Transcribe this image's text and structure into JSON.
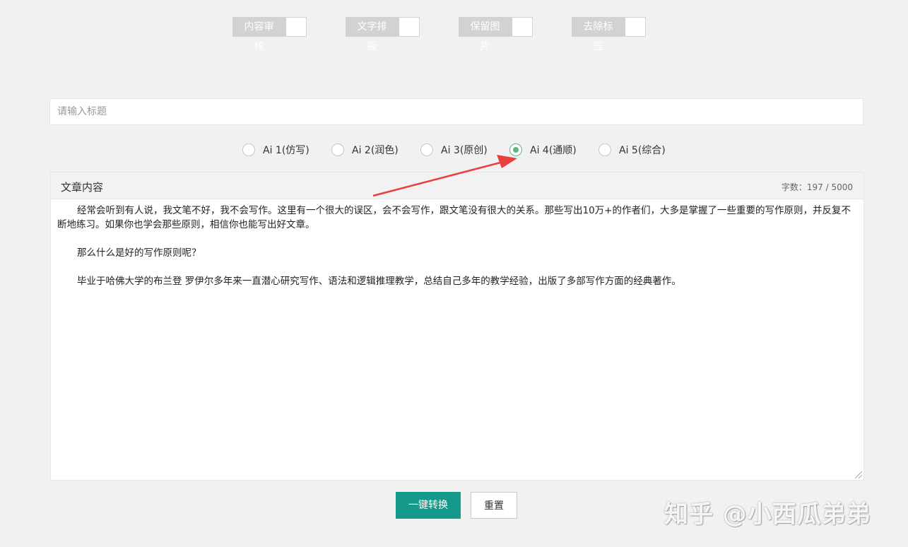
{
  "toggles": [
    {
      "label": "内容审核"
    },
    {
      "label": "文字排版"
    },
    {
      "label": "保留图片"
    },
    {
      "label": "去除标签"
    }
  ],
  "title_input": {
    "placeholder": "请输入标题",
    "value": ""
  },
  "ai_options": [
    {
      "label": "Ai 1(仿写)",
      "checked": false
    },
    {
      "label": "Ai 2(润色)",
      "checked": false
    },
    {
      "label": "Ai 3(原创)",
      "checked": false
    },
    {
      "label": "Ai 4(通顺)",
      "checked": true
    },
    {
      "label": "Ai 5(综合)",
      "checked": false
    }
  ],
  "article": {
    "header": "文章内容",
    "word_count": "字数：197 / 5000",
    "paragraphs": [
      "经常会听到有人说，我文笔不好，我不会写作。这里有一个很大的误区，会不会写作，跟文笔没有很大的关系。那些写出10万+的作者们，大多是掌握了一些重要的写作原则，并反复不断地练习。如果你也学会那些原则，相信你也能写出好文章。",
      "那么什么是好的写作原则呢？",
      "毕业于哈佛大学的布兰登 罗伊尔多年来一直潜心研究写作、语法和逻辑推理教学，总结自己多年的教学经验，出版了多部写作方面的经典著作。"
    ]
  },
  "buttons": {
    "convert": "一键转换",
    "reset": "重置"
  },
  "watermark": "知乎 @小西瓜弟弟",
  "colors": {
    "accent_green": "#5fb878",
    "primary_button": "#14998a",
    "annotation_arrow": "#e8403f"
  }
}
